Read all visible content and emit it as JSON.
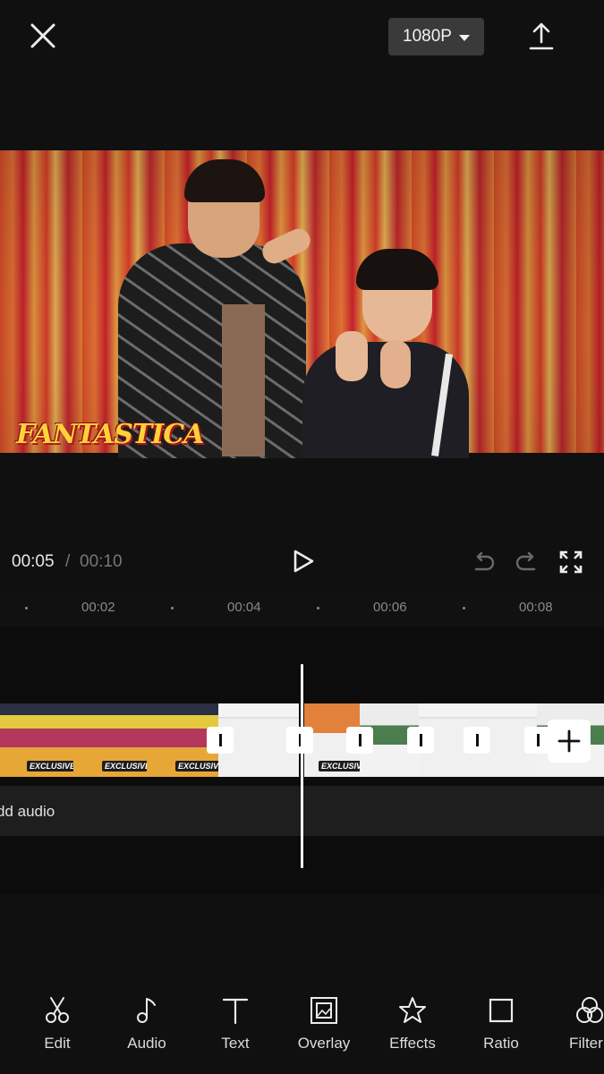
{
  "header": {
    "resolution": "1080P"
  },
  "preview": {
    "watermark": "FANTASTICA"
  },
  "playback": {
    "current_time": "00:05",
    "separator": "/",
    "total_time": "00:10"
  },
  "ruler": {
    "ticks": [
      "00:02",
      "00:04",
      "00:06",
      "00:08"
    ]
  },
  "clips": {
    "badge": "EXCLUSIVE"
  },
  "audio": {
    "label": "dd audio"
  },
  "toolbar": {
    "items": [
      {
        "label": "Edit",
        "icon": "scissors-icon"
      },
      {
        "label": "Audio",
        "icon": "music-note-icon"
      },
      {
        "label": "Text",
        "icon": "text-icon"
      },
      {
        "label": "Overlay",
        "icon": "overlay-icon"
      },
      {
        "label": "Effects",
        "icon": "effects-star-icon"
      },
      {
        "label": "Ratio",
        "icon": "ratio-square-icon"
      },
      {
        "label": "Filter",
        "icon": "filter-icon"
      }
    ]
  },
  "colors": {
    "background": "#101010",
    "timeline_bg": "#0c0c0c",
    "audio_track": "#1e1e1e",
    "resolution_button": "#3a3a3a"
  }
}
